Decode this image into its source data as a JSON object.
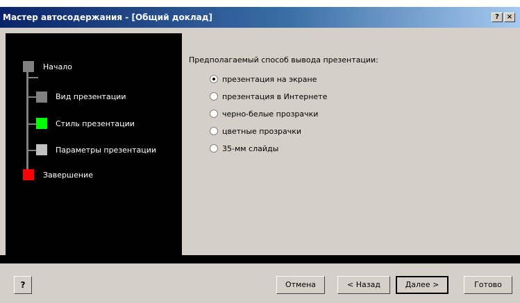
{
  "window": {
    "title": "Мастер автосодержания - [Общий доклад]",
    "help_button": "?",
    "close_button": "×"
  },
  "steps": [
    {
      "label": "Начало",
      "color": "#808080"
    },
    {
      "label": "Вид презентации",
      "color": "#808080"
    },
    {
      "label": "Стиль презентации",
      "color": "#00ff00"
    },
    {
      "label": "Параметры презентации",
      "color": "#c0c0c0"
    },
    {
      "label": "Завершение",
      "color": "#ff0000"
    }
  ],
  "content": {
    "question": "Предполагаемый способ вывода презентации:",
    "options": [
      {
        "label": "презентация на экране",
        "checked": true
      },
      {
        "label": "презентация в Интернете",
        "checked": false
      },
      {
        "label": "черно-белые прозрачки",
        "checked": false
      },
      {
        "label": "цветные прозрачки",
        "checked": false
      },
      {
        "label": "35-мм слайды",
        "checked": false
      }
    ]
  },
  "footer": {
    "help_icon": "help-book-icon",
    "help_glyph": "?",
    "cancel": "Отмена",
    "back": "< Назад",
    "next": "Далее >",
    "finish": "Готово"
  }
}
